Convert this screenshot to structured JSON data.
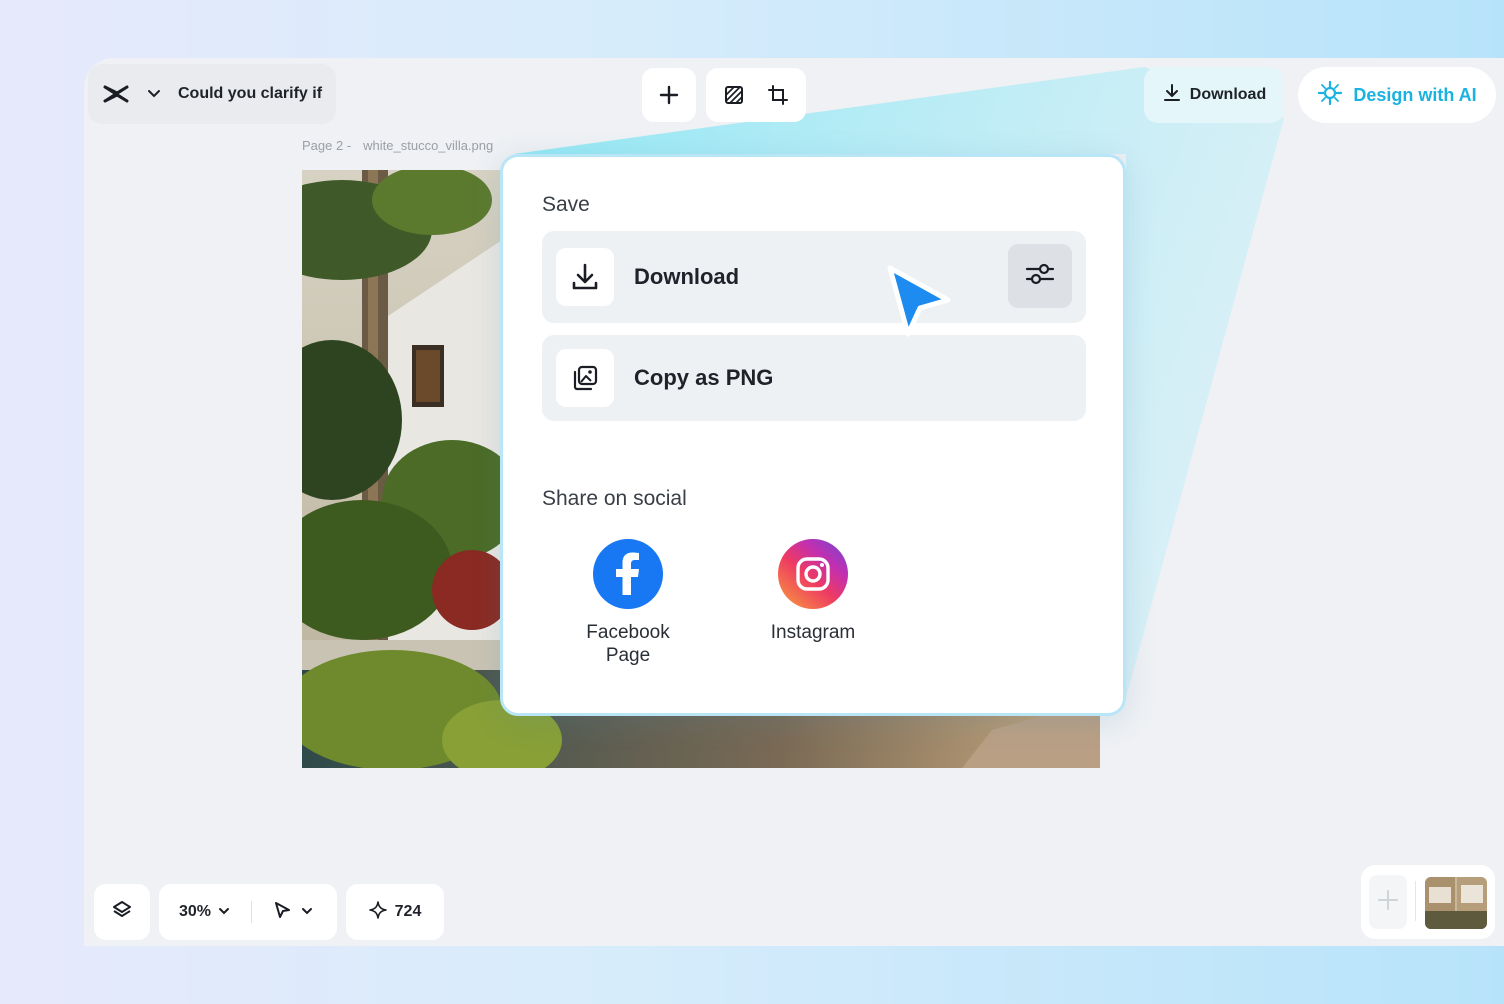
{
  "header": {
    "project_title": "Could you clarify if",
    "download_label": "Download",
    "ai_label": "Design with AI",
    "brand_color": "#1ab2e0"
  },
  "page_label": {
    "page": "Page 2 -",
    "filename": "white_stucco_villa.png"
  },
  "popup": {
    "save_heading": "Save",
    "download_label": "Download",
    "copy_label": "Copy as PNG",
    "share_heading": "Share on social",
    "social": [
      {
        "label": "Facebook Page",
        "icon": "facebook-icon",
        "color": "#1877f2"
      },
      {
        "label": "Instagram",
        "icon": "instagram-icon",
        "color": "#e1306c"
      }
    ]
  },
  "bottom_bar": {
    "zoom": "30%",
    "credits": "724"
  },
  "cursor_color": "#1e8bf0"
}
